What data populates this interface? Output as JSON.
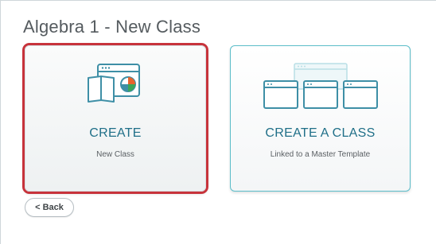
{
  "page": {
    "title": "Algebra 1 - New Class"
  },
  "cards": {
    "create": {
      "title": "CREATE",
      "subtitle": "New Class",
      "icon": "book-and-chart-window-icon"
    },
    "template": {
      "title": "CREATE A CLASS",
      "subtitle": "Linked to a Master Template",
      "icon": "linked-windows-icon"
    }
  },
  "back_button": {
    "label": "< Back"
  },
  "colors": {
    "accent_teal": "#1f6f88",
    "card_border_teal": "#5bbdc9",
    "selected_outline_red": "#c7333b",
    "chart_orange": "#e8632b",
    "chart_green": "#3aa657"
  }
}
